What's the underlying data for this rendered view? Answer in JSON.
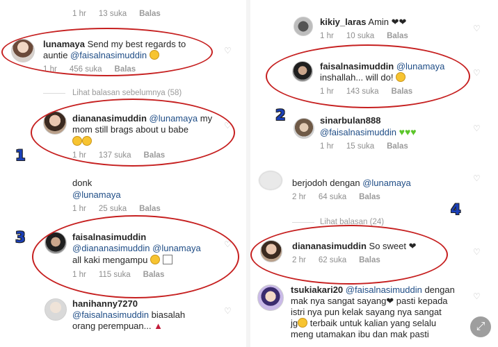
{
  "common": {
    "reply_label": "Balas"
  },
  "left": {
    "top_meta": {
      "time": "1 hr",
      "likes": "13 suka"
    },
    "c1": {
      "user": "lunamaya",
      "text1": "Send my best regards to",
      "text2_prefix": "auntie",
      "mention": "@faisalnasimuddin",
      "time": "1 hr",
      "likes": "456 suka"
    },
    "view_prev": "Lihat balasan sebelumnya (58)",
    "c2": {
      "user": "diananasimuddin",
      "mention": "@lunamaya",
      "text1": "my",
      "text2": "mom still brags about u babe",
      "time": "1 hr",
      "likes": "137 suka"
    },
    "c3": {
      "text1": "donk",
      "mention": "@lunamaya",
      "time": "1 hr",
      "likes": "25 suka"
    },
    "c4": {
      "user": "faisalnasimuddin",
      "mention1": "@diananasimuddin",
      "mention2": "@lunamaya",
      "text2": "all kaki mengampu",
      "time": "1 hr",
      "likes": "115 suka"
    },
    "c5": {
      "user": "hanihanny7270",
      "mention": "@faisalnasimuddin",
      "text1": "biasalah",
      "text2": "orang perempuan..."
    }
  },
  "right": {
    "r0": {
      "user": "kikiy_laras",
      "text": "Amin ❤❤",
      "time": "1 hr",
      "likes": "10 suka"
    },
    "r1": {
      "user": "faisalnasimuddin",
      "mention": "@lunamaya",
      "text2": "inshallah... will do!",
      "time": "1 hr",
      "likes": "143 suka"
    },
    "r2": {
      "user": "sinarbulan888",
      "mention": "@faisalnasimuddin",
      "time": "1 hr",
      "likes": "15 suka"
    },
    "r3": {
      "text1": "berjodoh dengan",
      "mention": "@lunamaya",
      "time": "2 hr",
      "likes": "64 suka"
    },
    "view_prev": "Lihat balasan (24)",
    "r4": {
      "user": "diananasimuddin",
      "text": "So sweet ❤",
      "time": "2 hr",
      "likes": "62 suka"
    },
    "r5": {
      "user": "tsukiakari20",
      "mention": "@faisalnasimuddin",
      "text1": "dengan",
      "text2": "mak nya sangat sayang❤ pasti kepada",
      "text3": "istri nya pun kelak sayang nya sangat",
      "text4": "terbaik untuk kalian yang selalu",
      "text4_prefix": "jg",
      "text5": "meng utamakan ibu dan mak pasti"
    }
  },
  "annotations": {
    "n1": "1",
    "n2": "2",
    "n3": "3",
    "n4": "4"
  },
  "colors": {
    "annotation_oval": "#c62020",
    "badge_blue": "#1a3fb8",
    "mention": "#1f4d86"
  }
}
